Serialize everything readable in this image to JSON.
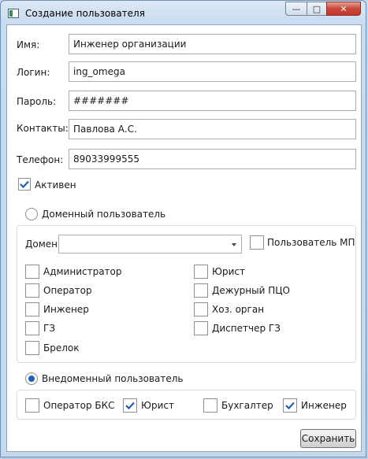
{
  "window": {
    "title": "Создание пользователя",
    "controls": {
      "minimize": "—",
      "maximize": "□",
      "close": "✕"
    }
  },
  "form": {
    "name_label": "Имя:",
    "name_value": "Инженер организации",
    "login_label": "Логин:",
    "login_value": "ing_omega",
    "password_label": "Пароль:",
    "password_value": "#######",
    "contacts_label": "Контакты:",
    "contacts_value": "Павлова А.С.",
    "phone_label": "Телефон:",
    "phone_value": "89033999555",
    "active_label": "Активен",
    "active_checked": true
  },
  "domain_section": {
    "radio_label": "Доменный пользователь",
    "selected": false,
    "domain_label": "Домен",
    "domain_value": "",
    "mp_user_label": "Пользователь МП",
    "mp_user_checked": false,
    "roles": [
      {
        "label": "Администратор",
        "checked": false
      },
      {
        "label": "Юрист",
        "checked": false
      },
      {
        "label": "Оператор",
        "checked": false
      },
      {
        "label": "Дежурный ПЦО",
        "checked": false
      },
      {
        "label": "Инженер",
        "checked": false
      },
      {
        "label": "Хоз. орган",
        "checked": false
      },
      {
        "label": "ГЗ",
        "checked": false
      },
      {
        "label": "Диспетчер ГЗ",
        "checked": false
      },
      {
        "label": "Брелок",
        "checked": false
      }
    ]
  },
  "nondomain_section": {
    "radio_label": "Внедоменный пользователь",
    "selected": true,
    "roles": [
      {
        "label": "Оператор БКС",
        "checked": false
      },
      {
        "label": "Юрист",
        "checked": true
      },
      {
        "label": "Бухгалтер",
        "checked": false
      },
      {
        "label": "Инженер",
        "checked": true
      }
    ]
  },
  "actions": {
    "save_label": "Сохранить"
  },
  "colors": {
    "accent": "#1f5fb8",
    "close_button": "#c13a2c"
  }
}
